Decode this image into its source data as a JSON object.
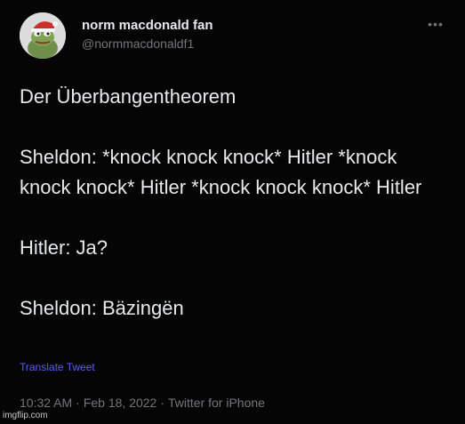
{
  "user": {
    "display_name": "norm macdonald fan",
    "handle": "@normmacdonaldf1",
    "avatar_icon": "pepe-santa-hat-avatar"
  },
  "more_icon": "more-dots-icon",
  "tweet": {
    "paragraphs": [
      "Der Überbangentheorem",
      "Sheldon: *knock knock knock* Hitler *knock knock knock* Hitler *knock knock knock* Hitler",
      "Hitler: Ja?",
      "Sheldon: Bäzingën"
    ],
    "translate_label": "Translate Tweet",
    "time": "10:32 AM",
    "date": "Feb 18, 2022",
    "source": "Twitter for iPhone",
    "separator": "·"
  },
  "watermark": "imgflip.com",
  "colors": {
    "background": "#050505",
    "text": "#e7e9ea",
    "muted": "#71767b",
    "link": "#5a5ff0"
  }
}
